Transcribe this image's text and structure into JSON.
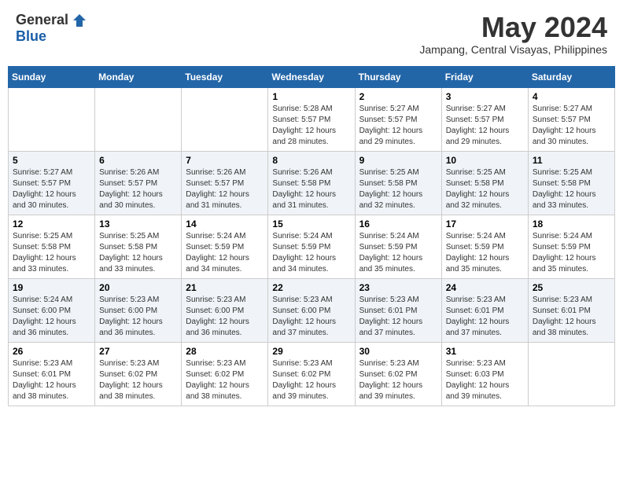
{
  "header": {
    "logo_general": "General",
    "logo_blue": "Blue",
    "month_year": "May 2024",
    "location": "Jampang, Central Visayas, Philippines"
  },
  "days_of_week": [
    "Sunday",
    "Monday",
    "Tuesday",
    "Wednesday",
    "Thursday",
    "Friday",
    "Saturday"
  ],
  "weeks": [
    {
      "days": [
        {
          "number": "",
          "info": ""
        },
        {
          "number": "",
          "info": ""
        },
        {
          "number": "",
          "info": ""
        },
        {
          "number": "1",
          "info": "Sunrise: 5:28 AM\nSunset: 5:57 PM\nDaylight: 12 hours\nand 28 minutes."
        },
        {
          "number": "2",
          "info": "Sunrise: 5:27 AM\nSunset: 5:57 PM\nDaylight: 12 hours\nand 29 minutes."
        },
        {
          "number": "3",
          "info": "Sunrise: 5:27 AM\nSunset: 5:57 PM\nDaylight: 12 hours\nand 29 minutes."
        },
        {
          "number": "4",
          "info": "Sunrise: 5:27 AM\nSunset: 5:57 PM\nDaylight: 12 hours\nand 30 minutes."
        }
      ]
    },
    {
      "days": [
        {
          "number": "5",
          "info": "Sunrise: 5:27 AM\nSunset: 5:57 PM\nDaylight: 12 hours\nand 30 minutes."
        },
        {
          "number": "6",
          "info": "Sunrise: 5:26 AM\nSunset: 5:57 PM\nDaylight: 12 hours\nand 30 minutes."
        },
        {
          "number": "7",
          "info": "Sunrise: 5:26 AM\nSunset: 5:57 PM\nDaylight: 12 hours\nand 31 minutes."
        },
        {
          "number": "8",
          "info": "Sunrise: 5:26 AM\nSunset: 5:58 PM\nDaylight: 12 hours\nand 31 minutes."
        },
        {
          "number": "9",
          "info": "Sunrise: 5:25 AM\nSunset: 5:58 PM\nDaylight: 12 hours\nand 32 minutes."
        },
        {
          "number": "10",
          "info": "Sunrise: 5:25 AM\nSunset: 5:58 PM\nDaylight: 12 hours\nand 32 minutes."
        },
        {
          "number": "11",
          "info": "Sunrise: 5:25 AM\nSunset: 5:58 PM\nDaylight: 12 hours\nand 33 minutes."
        }
      ]
    },
    {
      "days": [
        {
          "number": "12",
          "info": "Sunrise: 5:25 AM\nSunset: 5:58 PM\nDaylight: 12 hours\nand 33 minutes."
        },
        {
          "number": "13",
          "info": "Sunrise: 5:25 AM\nSunset: 5:58 PM\nDaylight: 12 hours\nand 33 minutes."
        },
        {
          "number": "14",
          "info": "Sunrise: 5:24 AM\nSunset: 5:59 PM\nDaylight: 12 hours\nand 34 minutes."
        },
        {
          "number": "15",
          "info": "Sunrise: 5:24 AM\nSunset: 5:59 PM\nDaylight: 12 hours\nand 34 minutes."
        },
        {
          "number": "16",
          "info": "Sunrise: 5:24 AM\nSunset: 5:59 PM\nDaylight: 12 hours\nand 35 minutes."
        },
        {
          "number": "17",
          "info": "Sunrise: 5:24 AM\nSunset: 5:59 PM\nDaylight: 12 hours\nand 35 minutes."
        },
        {
          "number": "18",
          "info": "Sunrise: 5:24 AM\nSunset: 5:59 PM\nDaylight: 12 hours\nand 35 minutes."
        }
      ]
    },
    {
      "days": [
        {
          "number": "19",
          "info": "Sunrise: 5:24 AM\nSunset: 6:00 PM\nDaylight: 12 hours\nand 36 minutes."
        },
        {
          "number": "20",
          "info": "Sunrise: 5:23 AM\nSunset: 6:00 PM\nDaylight: 12 hours\nand 36 minutes."
        },
        {
          "number": "21",
          "info": "Sunrise: 5:23 AM\nSunset: 6:00 PM\nDaylight: 12 hours\nand 36 minutes."
        },
        {
          "number": "22",
          "info": "Sunrise: 5:23 AM\nSunset: 6:00 PM\nDaylight: 12 hours\nand 37 minutes."
        },
        {
          "number": "23",
          "info": "Sunrise: 5:23 AM\nSunset: 6:01 PM\nDaylight: 12 hours\nand 37 minutes."
        },
        {
          "number": "24",
          "info": "Sunrise: 5:23 AM\nSunset: 6:01 PM\nDaylight: 12 hours\nand 37 minutes."
        },
        {
          "number": "25",
          "info": "Sunrise: 5:23 AM\nSunset: 6:01 PM\nDaylight: 12 hours\nand 38 minutes."
        }
      ]
    },
    {
      "days": [
        {
          "number": "26",
          "info": "Sunrise: 5:23 AM\nSunset: 6:01 PM\nDaylight: 12 hours\nand 38 minutes."
        },
        {
          "number": "27",
          "info": "Sunrise: 5:23 AM\nSunset: 6:02 PM\nDaylight: 12 hours\nand 38 minutes."
        },
        {
          "number": "28",
          "info": "Sunrise: 5:23 AM\nSunset: 6:02 PM\nDaylight: 12 hours\nand 38 minutes."
        },
        {
          "number": "29",
          "info": "Sunrise: 5:23 AM\nSunset: 6:02 PM\nDaylight: 12 hours\nand 39 minutes."
        },
        {
          "number": "30",
          "info": "Sunrise: 5:23 AM\nSunset: 6:02 PM\nDaylight: 12 hours\nand 39 minutes."
        },
        {
          "number": "31",
          "info": "Sunrise: 5:23 AM\nSunset: 6:03 PM\nDaylight: 12 hours\nand 39 minutes."
        },
        {
          "number": "",
          "info": ""
        }
      ]
    }
  ]
}
